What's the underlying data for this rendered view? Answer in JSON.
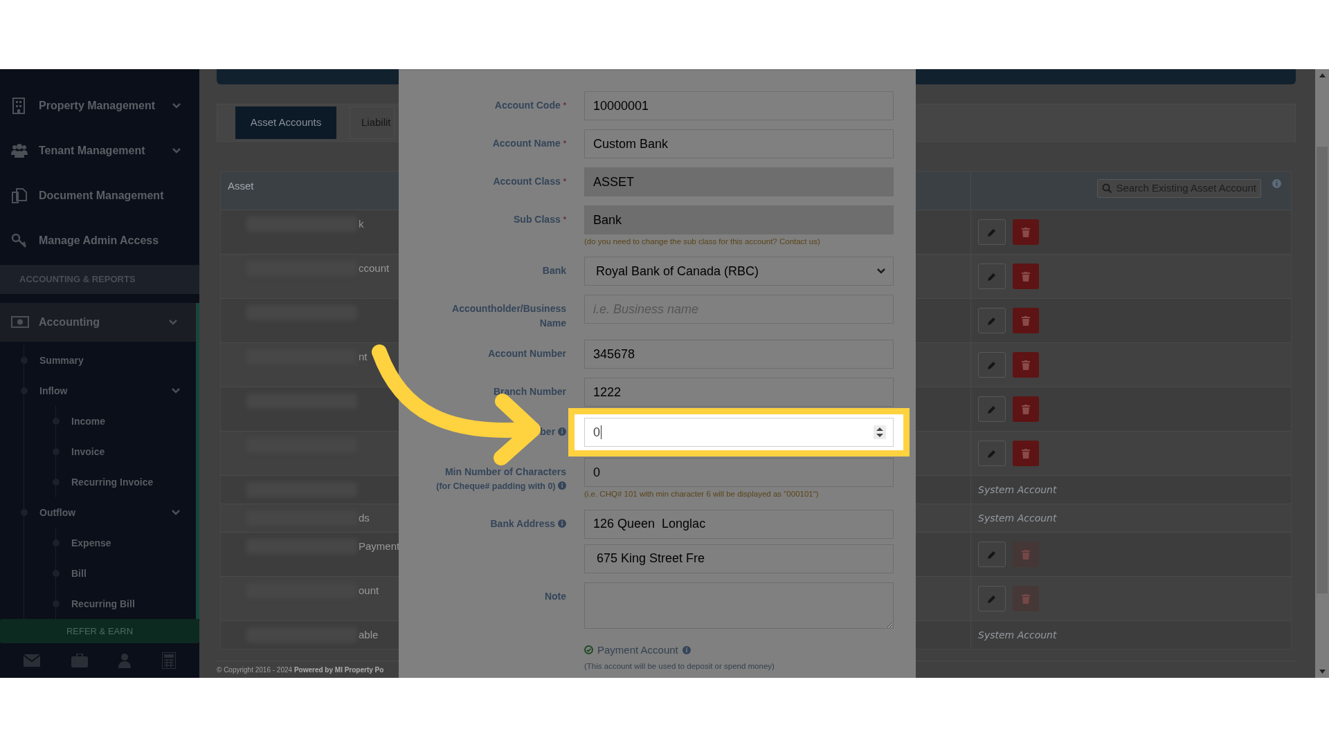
{
  "sidebar": {
    "items": [
      {
        "label": "Property Management",
        "expandable": true,
        "selected": false
      },
      {
        "label": "Tenant Management",
        "expandable": true,
        "selected": false
      },
      {
        "label": "Document Management",
        "expandable": false,
        "selected": false
      },
      {
        "label": "Manage Admin Access",
        "expandable": false,
        "selected": false
      }
    ],
    "section_title": "ACCOUNTING & REPORTS",
    "section_items": [
      {
        "label": "Accounting",
        "expandable": true,
        "selected": true,
        "children": [
          {
            "label": "Summary",
            "expandable": false
          },
          {
            "label": "Inflow",
            "expandable": true,
            "children": [
              {
                "label": "Income"
              },
              {
                "label": "Invoice"
              },
              {
                "label": "Recurring Invoice"
              }
            ]
          },
          {
            "label": "Outflow",
            "expandable": true,
            "children": [
              {
                "label": "Expense"
              },
              {
                "label": "Bill"
              },
              {
                "label": "Recurring Bill"
              }
            ]
          }
        ]
      }
    ],
    "refer_button": "REFER & EARN"
  },
  "page": {
    "tabs": [
      {
        "label": "Asset Accounts",
        "selected": true
      },
      {
        "label": "Liabilit",
        "selected": false
      }
    ],
    "table": {
      "column_1": "Asset",
      "search_button": "Search Existing Asset Account",
      "rows": [
        {
          "kind": "editable",
          "name_fragment": "k",
          "delete_disabled": false
        },
        {
          "kind": "editable",
          "name_fragment": "ccount",
          "delete_disabled": false
        },
        {
          "kind": "editable",
          "delete_disabled": false
        },
        {
          "kind": "editable",
          "name_fragment": "nt",
          "delete_disabled": false
        },
        {
          "kind": "editable",
          "delete_disabled": false
        },
        {
          "kind": "editable",
          "delete_disabled": false
        },
        {
          "kind": "system",
          "note": "System Account"
        },
        {
          "kind": "system",
          "name_fragment": "ds",
          "note": "System Account"
        },
        {
          "kind": "editable",
          "name_fragment": "Payment",
          "delete_disabled": true
        },
        {
          "kind": "editable",
          "name_fragment": "ount",
          "delete_disabled": true
        },
        {
          "kind": "system",
          "name_fragment": "able",
          "note": "System Account"
        }
      ]
    },
    "footer": "© Copyright 2016 - 2024 **Powered by MI Property Po**"
  },
  "modal": {
    "required_mark": "*",
    "fields": [
      {
        "kind": "input",
        "label": "Account Code",
        "required": true,
        "info": false,
        "value": "10000001",
        "disabled": false,
        "highlighted": false
      },
      {
        "kind": "input",
        "label": "Account Name",
        "required": true,
        "info": false,
        "value": "Custom Bank",
        "disabled": false,
        "highlighted": false
      },
      {
        "kind": "input",
        "label": "Account Class",
        "required": true,
        "info": false,
        "value": "ASSET",
        "disabled": true,
        "highlighted": false
      },
      {
        "kind": "input",
        "label": "Sub Class",
        "required": true,
        "info": false,
        "value": "Bank",
        "disabled": true,
        "highlighted": false,
        "help": "(do you need to change the sub class for this account? Contact us)"
      },
      {
        "kind": "select",
        "label": "Bank",
        "required": false,
        "info": false,
        "value": "Royal Bank of Canada (RBC)",
        "highlighted": false
      },
      {
        "kind": "input",
        "label": "Accountholder/Business Name",
        "required": false,
        "info": false,
        "placeholder": "i.e. Business name",
        "disabled": false,
        "highlighted": false
      },
      {
        "kind": "input",
        "label": "Account Number",
        "required": false,
        "info": false,
        "value": "345678",
        "disabled": false,
        "highlighted": false
      },
      {
        "kind": "input",
        "label": "Branch Number",
        "required": false,
        "info": false,
        "value": "1222",
        "disabled": false,
        "highlighted": false
      },
      {
        "kind": "number",
        "label": "ber",
        "required": false,
        "info": true,
        "value": "0",
        "highlighted": true
      },
      {
        "kind": "input",
        "label": "Min Number of Characters",
        "sublabel": "(for Cheque# padding with 0)",
        "required": false,
        "info": true,
        "value": "0",
        "disabled": false,
        "highlighted": false,
        "help": "(i.e. CHQ# 101 with min character 6 will be displayed as \"000101\")"
      },
      {
        "kind": "multi",
        "label": "Bank Address",
        "required": false,
        "info": true,
        "values": [
          "126 Queen  Longlac",
          " 675 King Street Fre"
        ],
        "highlighted": false
      },
      {
        "kind": "textarea",
        "label": "Note",
        "required": false,
        "info": false,
        "highlighted": false
      },
      {
        "kind": "check",
        "label": "Payment Account",
        "checked": true,
        "info": true,
        "highlighted": false,
        "help": "(This account will be used to deposit or spend money)"
      }
    ]
  }
}
